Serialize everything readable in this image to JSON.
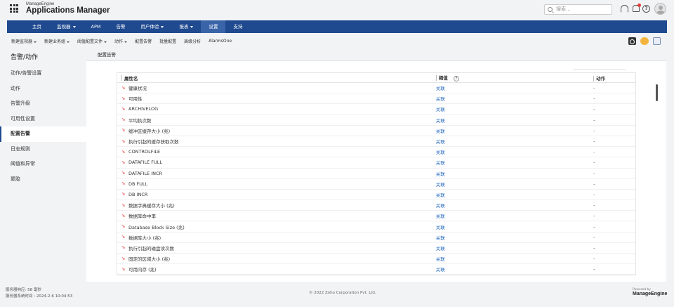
{
  "header": {
    "brand_sub": "ManageEngine",
    "brand_main": "Applications Manager",
    "search_placeholder": "搜索...",
    "help_glyph": "?"
  },
  "nav": {
    "items": [
      {
        "label": "主页",
        "caret": false,
        "active": false
      },
      {
        "label": "监视器",
        "caret": true,
        "active": false
      },
      {
        "label": "APM",
        "caret": false,
        "active": false
      },
      {
        "label": "告警",
        "caret": false,
        "active": false
      },
      {
        "label": "用户体验",
        "caret": true,
        "active": false
      },
      {
        "label": "报表",
        "caret": true,
        "active": false
      },
      {
        "label": "设置",
        "caret": false,
        "active": true
      },
      {
        "label": "支持",
        "caret": false,
        "active": false
      }
    ]
  },
  "subbar": {
    "items": [
      {
        "label": "新建监视器",
        "caret": true
      },
      {
        "label": "新建业务组",
        "caret": true
      },
      {
        "label": "阈值配置文件",
        "caret": true
      },
      {
        "label": "动作",
        "caret": true
      },
      {
        "label": "配置告警",
        "caret": false
      },
      {
        "label": "批量配置",
        "caret": false
      },
      {
        "label": "高级分析",
        "caret": false
      },
      {
        "label": "AlarmsOne",
        "caret": false
      }
    ]
  },
  "sidebar": {
    "title": "告警/动作",
    "items": [
      {
        "label": "动作/告警设置",
        "active": false
      },
      {
        "label": "动作",
        "active": false
      },
      {
        "label": "告警升级",
        "active": false
      },
      {
        "label": "可用性设置",
        "active": false
      },
      {
        "label": "配置告警",
        "active": true
      },
      {
        "label": "日志规则",
        "active": false
      },
      {
        "label": "阈值和异常",
        "active": false
      },
      {
        "label": "聚胶",
        "active": false
      }
    ]
  },
  "panel": {
    "title": "配置告警",
    "columns": {
      "attribute": "属性名",
      "threshold": "阈值",
      "action": "动作"
    },
    "help_glyph": "?",
    "arrow_glyph": "↘",
    "rows": [
      {
        "name": "健康状况",
        "threshold": "关联",
        "action": "-"
      },
      {
        "name": "可用性",
        "threshold": "关联",
        "action": "-"
      },
      {
        "name": "ARCHIVELOG",
        "threshold": "关联",
        "action": "-"
      },
      {
        "name": "平均执次数",
        "threshold": "关联",
        "action": "-"
      },
      {
        "name": "缓冲区缓存大小 (兆)",
        "threshold": "关联",
        "action": "-"
      },
      {
        "name": "执行引起的缓存获取次数",
        "threshold": "关联",
        "action": "-"
      },
      {
        "name": "CONTROLFILE",
        "threshold": "关联",
        "action": "-"
      },
      {
        "name": "DATAFILE FULL",
        "threshold": "关联",
        "action": "-"
      },
      {
        "name": "DATAFILE INCR",
        "threshold": "关联",
        "action": "-"
      },
      {
        "name": "DB FULL",
        "threshold": "关联",
        "action": "-"
      },
      {
        "name": "DB INCR",
        "threshold": "关联",
        "action": "-"
      },
      {
        "name": "数据字典缓存大小 (兆)",
        "threshold": "关联",
        "action": "-"
      },
      {
        "name": "数据库命中率",
        "threshold": "关联",
        "action": "-"
      },
      {
        "name": "Database Block Size (兆)",
        "threshold": "关联",
        "action": "-"
      },
      {
        "name": "数据库大小 (兆)",
        "threshold": "关联",
        "action": "-"
      },
      {
        "name": "执行引起的磁盘读次数",
        "threshold": "关联",
        "action": "-"
      },
      {
        "name": "固定的区域大小 (兆)",
        "threshold": "关联",
        "action": "-"
      },
      {
        "name": "可用内存 (兆)",
        "threshold": "关联",
        "action": "-"
      }
    ]
  },
  "footer": {
    "status_line1": "服务器响应: 58 毫秒",
    "status_line2": "服务器系统时间 : 2024-2-6 10:04:53",
    "copyright": "© 2022 Zoho Corporation Pvt. Ltd.",
    "powered_by": "Powered by",
    "vendor": "ManageEngine"
  }
}
